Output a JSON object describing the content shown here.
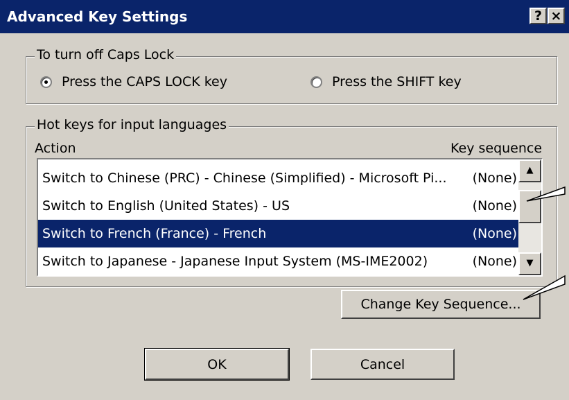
{
  "window": {
    "title": "Advanced Key Settings",
    "help_label": "?",
    "close_label": "×"
  },
  "caps_lock": {
    "group_label": "To turn off Caps Lock",
    "options": [
      {
        "label": "Press the CAPS LOCK key",
        "checked": true
      },
      {
        "label": "Press the SHIFT key",
        "checked": false
      }
    ]
  },
  "hot_keys": {
    "group_label": "Hot keys for input languages",
    "columns": {
      "action": "Action",
      "key_sequence": "Key sequence"
    },
    "rows": [
      {
        "action": "Switch to Chinese (PRC) - Chinese (Simplified) - Microsoft Pi...",
        "key": "(None)",
        "selected": false
      },
      {
        "action": "Switch to English (United States) - US",
        "key": "(None)",
        "selected": false
      },
      {
        "action": "Switch to French (France) - French",
        "key": "(None)",
        "selected": true
      },
      {
        "action": "Switch to Japanese - Japanese Input System (MS-IME2002)",
        "key": "(None)",
        "selected": false
      }
    ],
    "change_button": "Change Key Sequence..."
  },
  "footer": {
    "ok_label": "OK",
    "cancel_label": "Cancel"
  },
  "colors": {
    "titlebar": "#0a246a",
    "dialog_face": "#d4d0c8",
    "selection": "#0a246a"
  }
}
